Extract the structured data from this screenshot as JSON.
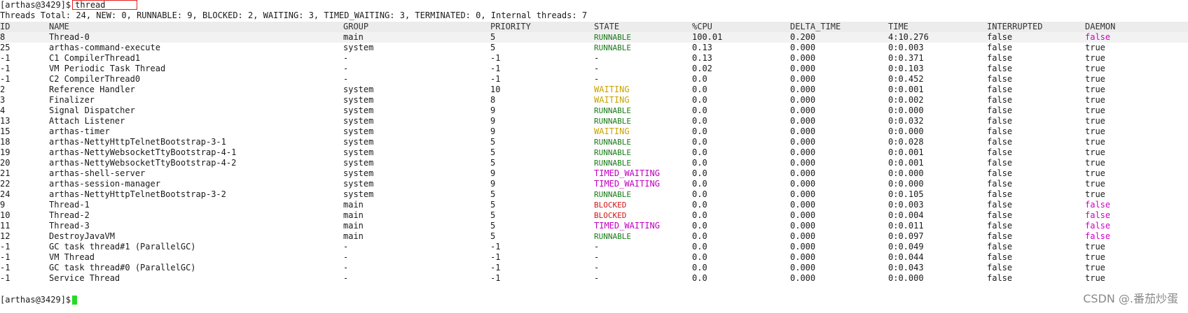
{
  "terminal": {
    "prompt": "[arthas@3429]$",
    "command": "thread",
    "summary": "Threads Total: 24, NEW: 0, RUNNABLE: 9, BLOCKED: 2, WAITING: 3, TIMED_WAITING: 3, TERMINATED: 0, Internal threads: 7",
    "bottom_prompt": "[arthas@3429]$"
  },
  "colors": {
    "RUNNABLE": "#1a7a1a",
    "WAITING": "#c9a300",
    "TIMED_WAITING": "#c000c0",
    "BLOCKED": "#d01818",
    "daemon_false": "#d000c8",
    "cursor": "#22dd22",
    "command_box": "#e02020"
  },
  "table": {
    "columns": [
      "ID",
      "NAME",
      "GROUP",
      "PRIORITY",
      "STATE",
      "%CPU",
      "DELTA_TIME",
      "TIME",
      "INTERRUPTED",
      "DAEMON"
    ],
    "rows": [
      [
        "8",
        "Thread-0",
        "main",
        "5",
        "RUNNABLE",
        "100.01",
        "0.200",
        "4:10.276",
        "false",
        "false"
      ],
      [
        "25",
        "arthas-command-execute",
        "system",
        "5",
        "RUNNABLE",
        "0.13",
        "0.000",
        "0:0.003",
        "false",
        "true"
      ],
      [
        "-1",
        "C1 CompilerThread1",
        "-",
        "-1",
        "-",
        "0.13",
        "0.000",
        "0:0.371",
        "false",
        "true"
      ],
      [
        "-1",
        "VM Periodic Task Thread",
        "-",
        "-1",
        "-",
        "0.02",
        "0.000",
        "0:0.103",
        "false",
        "true"
      ],
      [
        "-1",
        "C2 CompilerThread0",
        "-",
        "-1",
        "-",
        "0.0",
        "0.000",
        "0:0.452",
        "false",
        "true"
      ],
      [
        "2",
        "Reference Handler",
        "system",
        "10",
        "WAITING",
        "0.0",
        "0.000",
        "0:0.001",
        "false",
        "true"
      ],
      [
        "3",
        "Finalizer",
        "system",
        "8",
        "WAITING",
        "0.0",
        "0.000",
        "0:0.002",
        "false",
        "true"
      ],
      [
        "4",
        "Signal Dispatcher",
        "system",
        "9",
        "RUNNABLE",
        "0.0",
        "0.000",
        "0:0.000",
        "false",
        "true"
      ],
      [
        "13",
        "Attach Listener",
        "system",
        "9",
        "RUNNABLE",
        "0.0",
        "0.000",
        "0:0.032",
        "false",
        "true"
      ],
      [
        "15",
        "arthas-timer",
        "system",
        "9",
        "WAITING",
        "0.0",
        "0.000",
        "0:0.000",
        "false",
        "true"
      ],
      [
        "18",
        "arthas-NettyHttpTelnetBootstrap-3-1",
        "system",
        "5",
        "RUNNABLE",
        "0.0",
        "0.000",
        "0:0.028",
        "false",
        "true"
      ],
      [
        "19",
        "arthas-NettyWebsocketTtyBootstrap-4-1",
        "system",
        "5",
        "RUNNABLE",
        "0.0",
        "0.000",
        "0:0.001",
        "false",
        "true"
      ],
      [
        "20",
        "arthas-NettyWebsocketTtyBootstrap-4-2",
        "system",
        "5",
        "RUNNABLE",
        "0.0",
        "0.000",
        "0:0.001",
        "false",
        "true"
      ],
      [
        "21",
        "arthas-shell-server",
        "system",
        "9",
        "TIMED_WAITING",
        "0.0",
        "0.000",
        "0:0.000",
        "false",
        "true"
      ],
      [
        "22",
        "arthas-session-manager",
        "system",
        "9",
        "TIMED_WAITING",
        "0.0",
        "0.000",
        "0:0.000",
        "false",
        "true"
      ],
      [
        "24",
        "arthas-NettyHttpTelnetBootstrap-3-2",
        "system",
        "5",
        "RUNNABLE",
        "0.0",
        "0.000",
        "0:0.105",
        "false",
        "true"
      ],
      [
        "9",
        "Thread-1",
        "main",
        "5",
        "BLOCKED",
        "0.0",
        "0.000",
        "0:0.003",
        "false",
        "false"
      ],
      [
        "10",
        "Thread-2",
        "main",
        "5",
        "BLOCKED",
        "0.0",
        "0.000",
        "0:0.004",
        "false",
        "false"
      ],
      [
        "11",
        "Thread-3",
        "main",
        "5",
        "TIMED_WAITING",
        "0.0",
        "0.000",
        "0:0.011",
        "false",
        "false"
      ],
      [
        "12",
        "DestroyJavaVM",
        "main",
        "5",
        "RUNNABLE",
        "0.0",
        "0.000",
        "0:0.097",
        "false",
        "false"
      ],
      [
        "-1",
        "GC task thread#1 (ParallelGC)",
        "-",
        "-1",
        "-",
        "0.0",
        "0.000",
        "0:0.049",
        "false",
        "true"
      ],
      [
        "-1",
        "VM Thread",
        "-",
        "-1",
        "-",
        "0.0",
        "0.000",
        "0:0.044",
        "false",
        "true"
      ],
      [
        "-1",
        "GC task thread#0 (ParallelGC)",
        "-",
        "-1",
        "-",
        "0.0",
        "0.000",
        "0:0.043",
        "false",
        "true"
      ],
      [
        "-1",
        "Service Thread",
        "-",
        "-1",
        "-",
        "0.0",
        "0.000",
        "0:0.000",
        "false",
        "true"
      ]
    ]
  },
  "watermark": "CSDN @.番茄炒蛋"
}
